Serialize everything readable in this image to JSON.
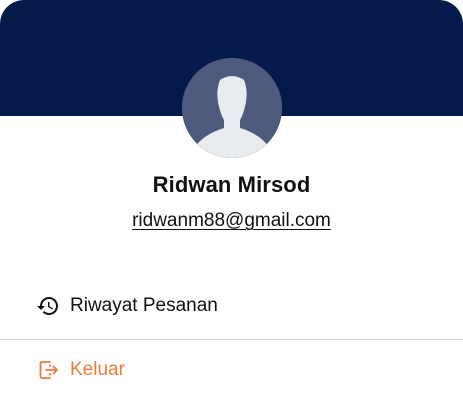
{
  "profile": {
    "name": "Ridwan Mirsod",
    "email": "ridwanm88@gmail.com",
    "avatar_icon": "user-silhouette-icon"
  },
  "menu": {
    "items": [
      {
        "label": "Riwayat Pesanan",
        "icon": "history-icon"
      },
      {
        "label": "Keluar",
        "icon": "logout-icon",
        "color": "#f07a3a"
      }
    ]
  },
  "colors": {
    "header": "#031a4b",
    "accent": "#f07a3a"
  }
}
